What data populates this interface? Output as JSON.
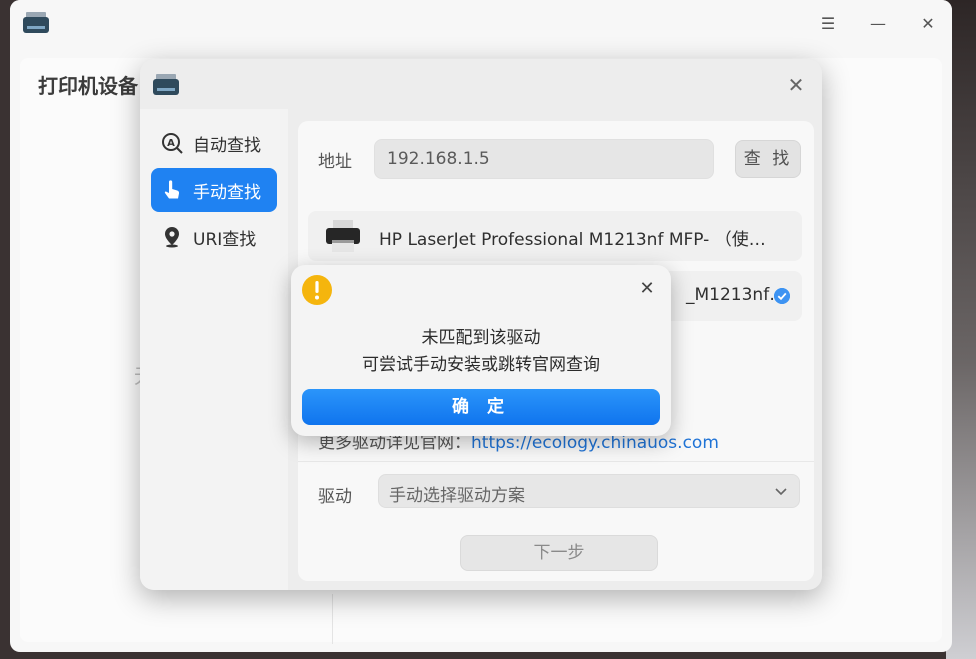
{
  "window": {
    "title": "打印机设备",
    "background_hint": "无"
  },
  "dialog": {
    "nav": [
      {
        "label": "自动查找",
        "icon": "auto-search-icon"
      },
      {
        "label": "手动查找",
        "icon": "hand-pointer-icon",
        "active": true
      },
      {
        "label": "URI查找",
        "icon": "location-pin-icon"
      }
    ],
    "address_label": "地址",
    "address_value": "192.168.1.5",
    "find_button": "查 找",
    "printers": [
      {
        "name": "HP LaserJet Professional M1213nf MFP- （使…"
      },
      {
        "name": "_M1213nf…",
        "selected": true
      }
    ],
    "more_text_prefix": "更多驱动详见官网：",
    "more_text_link": "https://ecology.chinauos.com",
    "driver_label": "驱动",
    "driver_select": "手动选择驱动方案",
    "next_button": "下一步"
  },
  "alert": {
    "line1": "未匹配到该驱动",
    "line2": "可尝试手动安装或跳转官网查询",
    "ok_button": "确 定"
  },
  "colors": {
    "accent": "#1f82f2",
    "warning": "#f5b50d",
    "link": "#1f73d6"
  }
}
